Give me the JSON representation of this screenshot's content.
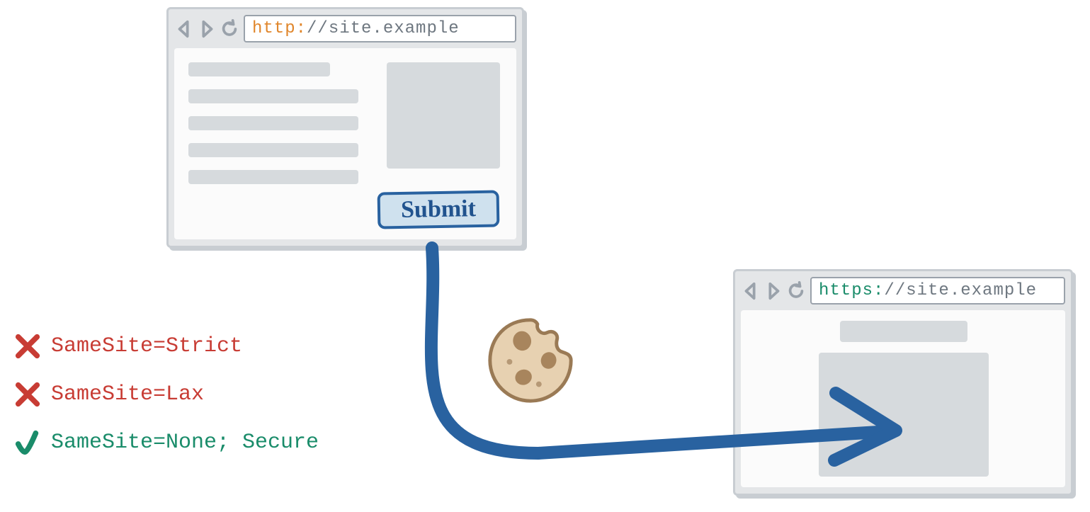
{
  "source_browser": {
    "url_scheme": "http:",
    "url_rest": "//site.example",
    "submit_label": "Submit"
  },
  "target_browser": {
    "url_scheme": "https:",
    "url_rest": "//site.example"
  },
  "legend": {
    "strict": {
      "label": "SameSite=Strict",
      "allowed": false
    },
    "lax": {
      "label": "SameSite=Lax",
      "allowed": false
    },
    "none": {
      "label": "SameSite=None; Secure",
      "allowed": true
    }
  },
  "icons": {
    "back": "back-icon",
    "forward": "forward-icon",
    "reload": "reload-icon",
    "cookie": "cookie-icon",
    "cross": "cross-mark-icon",
    "check": "check-mark-icon"
  },
  "colors": {
    "arrow": "#2962a0",
    "red": "#c83c34",
    "green": "#1a8c6a",
    "orange": "#e0862b",
    "grey": "#9aa2ab"
  }
}
